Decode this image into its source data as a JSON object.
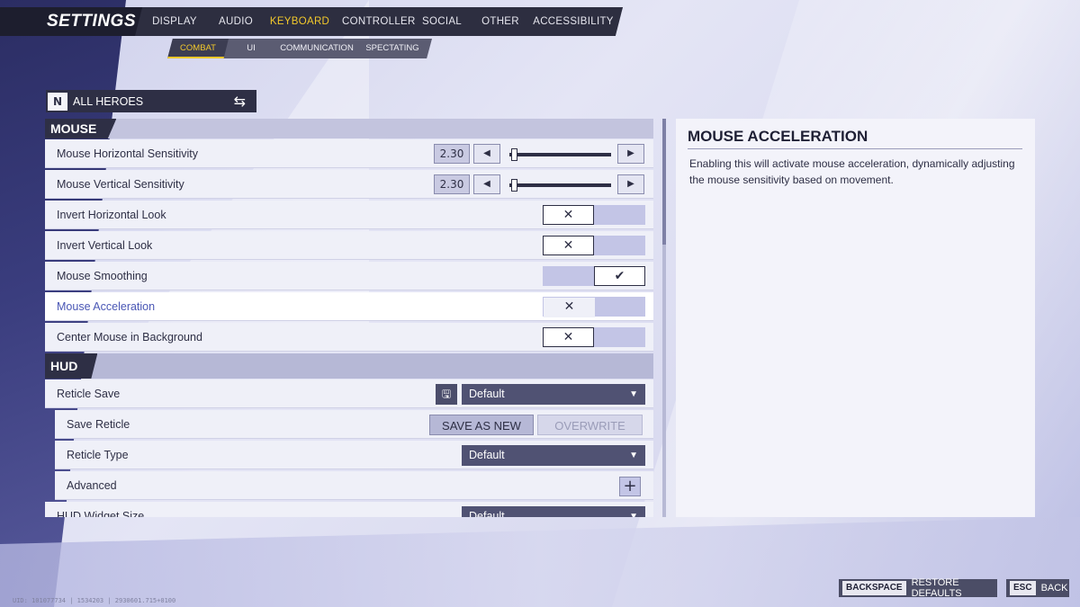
{
  "header": {
    "title": "SETTINGS",
    "tabs": [
      "DISPLAY",
      "AUDIO",
      "KEYBOARD",
      "CONTROLLER",
      "SOCIAL",
      "OTHER",
      "ACCESSIBILITY"
    ],
    "active_tab": "KEYBOARD",
    "sub_tabs": [
      "COMBAT",
      "UI",
      "COMMUNICATION",
      "SPECTATING"
    ],
    "active_sub_tab": "COMBAT"
  },
  "hero_selector": {
    "label": "ALL HEROES",
    "logo": "N"
  },
  "sections": {
    "mouse": "MOUSE",
    "hud": "HUD"
  },
  "mouse_rows": {
    "h_sens": {
      "label": "Mouse Horizontal Sensitivity",
      "value": "2.30",
      "level": 0.02
    },
    "v_sens": {
      "label": "Mouse Vertical Sensitivity",
      "value": "2.30",
      "level": 0.02
    },
    "invert_h": {
      "label": "Invert Horizontal Look",
      "state": "off"
    },
    "invert_v": {
      "label": "Invert Vertical Look",
      "state": "off"
    },
    "smoothing": {
      "label": "Mouse Smoothing",
      "state": "on"
    },
    "acceleration": {
      "label": "Mouse Acceleration",
      "state": "off"
    },
    "center_bg": {
      "label": "Center Mouse in Background",
      "state": "off"
    }
  },
  "hud_rows": {
    "reticle_save": {
      "label": "Reticle Save",
      "value": "Default"
    },
    "save_reticle": {
      "label": "Save Reticle",
      "save_new": "SAVE AS NEW",
      "overwrite": "OVERWRITE"
    },
    "reticle_type": {
      "label": "Reticle Type",
      "value": "Default"
    },
    "advanced": {
      "label": "Advanced"
    },
    "widget_size": {
      "label": "HUD Widget Size",
      "value": "Default"
    }
  },
  "description": {
    "title": "MOUSE ACCELERATION",
    "text": "Enabling this will activate mouse acceleration, dynamically adjusting the mouse sensitivity based on movement."
  },
  "footer": {
    "restore_key": "BACKSPACE",
    "restore_label": "RESTORE DEFAULTS",
    "back_key": "ESC",
    "back_label": "BACK",
    "uid": "UID: 101077734 | 1534203 | 2930601.715+0100"
  },
  "glyphs": {
    "check": "✔",
    "cross": "✕",
    "left": "◀",
    "right": "▶",
    "caret": "▼",
    "plus": "+",
    "swap": "⇆",
    "file": "🖫"
  }
}
